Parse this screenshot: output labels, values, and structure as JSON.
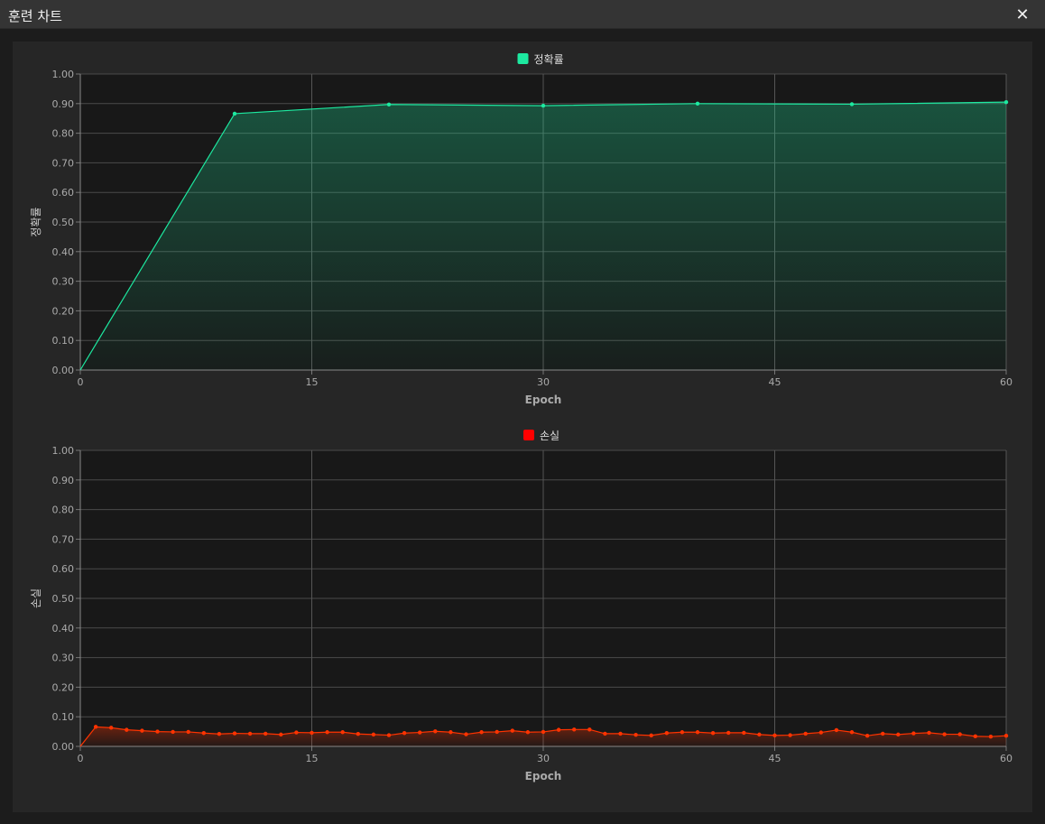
{
  "window": {
    "title": "훈련 차트",
    "close_glyph": "✕"
  },
  "colors": {
    "accuracy": "#1de9a0",
    "loss": "#ff3300",
    "loss_legend": "#ff0000"
  },
  "chart_data": [
    {
      "type": "area",
      "legend": "정확률",
      "ylabel": "정확률",
      "xlabel": "Epoch",
      "xlim": [
        0,
        60
      ],
      "ylim": [
        0,
        1
      ],
      "xticks": [
        0,
        15,
        30,
        45,
        60
      ],
      "yticks": [
        0,
        0.1,
        0.2,
        0.3,
        0.4,
        0.5,
        0.6,
        0.7,
        0.8,
        0.9,
        1.0
      ],
      "ytick_labels": [
        "0.00",
        "0.10",
        "0.20",
        "0.30",
        "0.40",
        "0.50",
        "0.60",
        "0.70",
        "0.80",
        "0.90",
        "1.00"
      ],
      "xtick_labels": [
        "0",
        "15",
        "30",
        "45",
        "60"
      ],
      "grid": true,
      "legend_position": "top-center",
      "series": [
        {
          "name": "정확률",
          "x": [
            0,
            10,
            20,
            30,
            40,
            50,
            60
          ],
          "y": [
            0.0,
            0.866,
            0.897,
            0.893,
            0.9,
            0.898,
            0.905
          ]
        }
      ]
    },
    {
      "type": "area",
      "legend": "손실",
      "ylabel": "손실",
      "xlabel": "Epoch",
      "xlim": [
        0,
        60
      ],
      "ylim": [
        0,
        1
      ],
      "xticks": [
        0,
        15,
        30,
        45,
        60
      ],
      "yticks": [
        0,
        0.1,
        0.2,
        0.3,
        0.4,
        0.5,
        0.6,
        0.7,
        0.8,
        0.9,
        1.0
      ],
      "ytick_labels": [
        "0.00",
        "0.10",
        "0.20",
        "0.30",
        "0.40",
        "0.50",
        "0.60",
        "0.70",
        "0.80",
        "0.90",
        "1.00"
      ],
      "xtick_labels": [
        "0",
        "15",
        "30",
        "45",
        "60"
      ],
      "grid": true,
      "legend_position": "top-center",
      "series": [
        {
          "name": "손실",
          "x": [
            0,
            1,
            2,
            3,
            4,
            5,
            6,
            7,
            8,
            9,
            10,
            11,
            12,
            13,
            14,
            15,
            16,
            17,
            18,
            19,
            20,
            21,
            22,
            23,
            24,
            25,
            26,
            27,
            28,
            29,
            30,
            31,
            32,
            33,
            34,
            35,
            36,
            37,
            38,
            39,
            40,
            41,
            42,
            43,
            44,
            45,
            46,
            47,
            48,
            49,
            50,
            51,
            52,
            53,
            54,
            55,
            56,
            57,
            58,
            59,
            60
          ],
          "y": [
            0.0,
            0.066,
            0.063,
            0.056,
            0.053,
            0.05,
            0.049,
            0.049,
            0.045,
            0.042,
            0.044,
            0.043,
            0.043,
            0.04,
            0.047,
            0.046,
            0.048,
            0.048,
            0.042,
            0.04,
            0.038,
            0.045,
            0.047,
            0.051,
            0.048,
            0.041,
            0.048,
            0.049,
            0.053,
            0.048,
            0.049,
            0.056,
            0.057,
            0.057,
            0.043,
            0.043,
            0.039,
            0.037,
            0.045,
            0.048,
            0.048,
            0.045,
            0.046,
            0.046,
            0.04,
            0.037,
            0.038,
            0.043,
            0.047,
            0.055,
            0.048,
            0.036,
            0.043,
            0.04,
            0.044,
            0.046,
            0.041,
            0.041,
            0.034,
            0.033,
            0.036
          ]
        }
      ]
    }
  ]
}
